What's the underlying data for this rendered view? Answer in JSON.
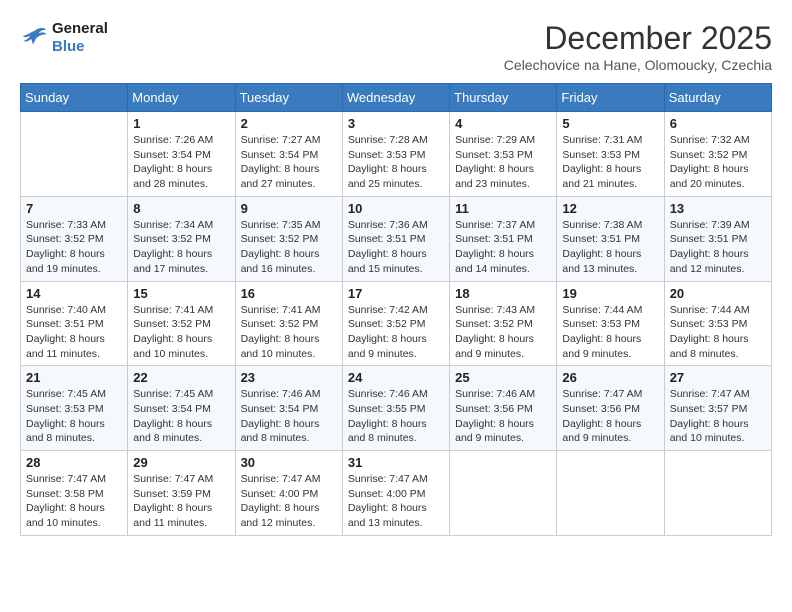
{
  "header": {
    "logo_line1": "General",
    "logo_line2": "Blue",
    "month_title": "December 2025",
    "subtitle": "Celechovice na Hane, Olomoucky, Czechia"
  },
  "weekdays": [
    "Sunday",
    "Monday",
    "Tuesday",
    "Wednesday",
    "Thursday",
    "Friday",
    "Saturday"
  ],
  "weeks": [
    [
      {
        "day": "",
        "info": ""
      },
      {
        "day": "1",
        "info": "Sunrise: 7:26 AM\nSunset: 3:54 PM\nDaylight: 8 hours\nand 28 minutes."
      },
      {
        "day": "2",
        "info": "Sunrise: 7:27 AM\nSunset: 3:54 PM\nDaylight: 8 hours\nand 27 minutes."
      },
      {
        "day": "3",
        "info": "Sunrise: 7:28 AM\nSunset: 3:53 PM\nDaylight: 8 hours\nand 25 minutes."
      },
      {
        "day": "4",
        "info": "Sunrise: 7:29 AM\nSunset: 3:53 PM\nDaylight: 8 hours\nand 23 minutes."
      },
      {
        "day": "5",
        "info": "Sunrise: 7:31 AM\nSunset: 3:53 PM\nDaylight: 8 hours\nand 21 minutes."
      },
      {
        "day": "6",
        "info": "Sunrise: 7:32 AM\nSunset: 3:52 PM\nDaylight: 8 hours\nand 20 minutes."
      }
    ],
    [
      {
        "day": "7",
        "info": "Sunrise: 7:33 AM\nSunset: 3:52 PM\nDaylight: 8 hours\nand 19 minutes."
      },
      {
        "day": "8",
        "info": "Sunrise: 7:34 AM\nSunset: 3:52 PM\nDaylight: 8 hours\nand 17 minutes."
      },
      {
        "day": "9",
        "info": "Sunrise: 7:35 AM\nSunset: 3:52 PM\nDaylight: 8 hours\nand 16 minutes."
      },
      {
        "day": "10",
        "info": "Sunrise: 7:36 AM\nSunset: 3:51 PM\nDaylight: 8 hours\nand 15 minutes."
      },
      {
        "day": "11",
        "info": "Sunrise: 7:37 AM\nSunset: 3:51 PM\nDaylight: 8 hours\nand 14 minutes."
      },
      {
        "day": "12",
        "info": "Sunrise: 7:38 AM\nSunset: 3:51 PM\nDaylight: 8 hours\nand 13 minutes."
      },
      {
        "day": "13",
        "info": "Sunrise: 7:39 AM\nSunset: 3:51 PM\nDaylight: 8 hours\nand 12 minutes."
      }
    ],
    [
      {
        "day": "14",
        "info": "Sunrise: 7:40 AM\nSunset: 3:51 PM\nDaylight: 8 hours\nand 11 minutes."
      },
      {
        "day": "15",
        "info": "Sunrise: 7:41 AM\nSunset: 3:52 PM\nDaylight: 8 hours\nand 10 minutes."
      },
      {
        "day": "16",
        "info": "Sunrise: 7:41 AM\nSunset: 3:52 PM\nDaylight: 8 hours\nand 10 minutes."
      },
      {
        "day": "17",
        "info": "Sunrise: 7:42 AM\nSunset: 3:52 PM\nDaylight: 8 hours\nand 9 minutes."
      },
      {
        "day": "18",
        "info": "Sunrise: 7:43 AM\nSunset: 3:52 PM\nDaylight: 8 hours\nand 9 minutes."
      },
      {
        "day": "19",
        "info": "Sunrise: 7:44 AM\nSunset: 3:53 PM\nDaylight: 8 hours\nand 9 minutes."
      },
      {
        "day": "20",
        "info": "Sunrise: 7:44 AM\nSunset: 3:53 PM\nDaylight: 8 hours\nand 8 minutes."
      }
    ],
    [
      {
        "day": "21",
        "info": "Sunrise: 7:45 AM\nSunset: 3:53 PM\nDaylight: 8 hours\nand 8 minutes."
      },
      {
        "day": "22",
        "info": "Sunrise: 7:45 AM\nSunset: 3:54 PM\nDaylight: 8 hours\nand 8 minutes."
      },
      {
        "day": "23",
        "info": "Sunrise: 7:46 AM\nSunset: 3:54 PM\nDaylight: 8 hours\nand 8 minutes."
      },
      {
        "day": "24",
        "info": "Sunrise: 7:46 AM\nSunset: 3:55 PM\nDaylight: 8 hours\nand 8 minutes."
      },
      {
        "day": "25",
        "info": "Sunrise: 7:46 AM\nSunset: 3:56 PM\nDaylight: 8 hours\nand 9 minutes."
      },
      {
        "day": "26",
        "info": "Sunrise: 7:47 AM\nSunset: 3:56 PM\nDaylight: 8 hours\nand 9 minutes."
      },
      {
        "day": "27",
        "info": "Sunrise: 7:47 AM\nSunset: 3:57 PM\nDaylight: 8 hours\nand 10 minutes."
      }
    ],
    [
      {
        "day": "28",
        "info": "Sunrise: 7:47 AM\nSunset: 3:58 PM\nDaylight: 8 hours\nand 10 minutes."
      },
      {
        "day": "29",
        "info": "Sunrise: 7:47 AM\nSunset: 3:59 PM\nDaylight: 8 hours\nand 11 minutes."
      },
      {
        "day": "30",
        "info": "Sunrise: 7:47 AM\nSunset: 4:00 PM\nDaylight: 8 hours\nand 12 minutes."
      },
      {
        "day": "31",
        "info": "Sunrise: 7:47 AM\nSunset: 4:00 PM\nDaylight: 8 hours\nand 13 minutes."
      },
      {
        "day": "",
        "info": ""
      },
      {
        "day": "",
        "info": ""
      },
      {
        "day": "",
        "info": ""
      }
    ]
  ]
}
